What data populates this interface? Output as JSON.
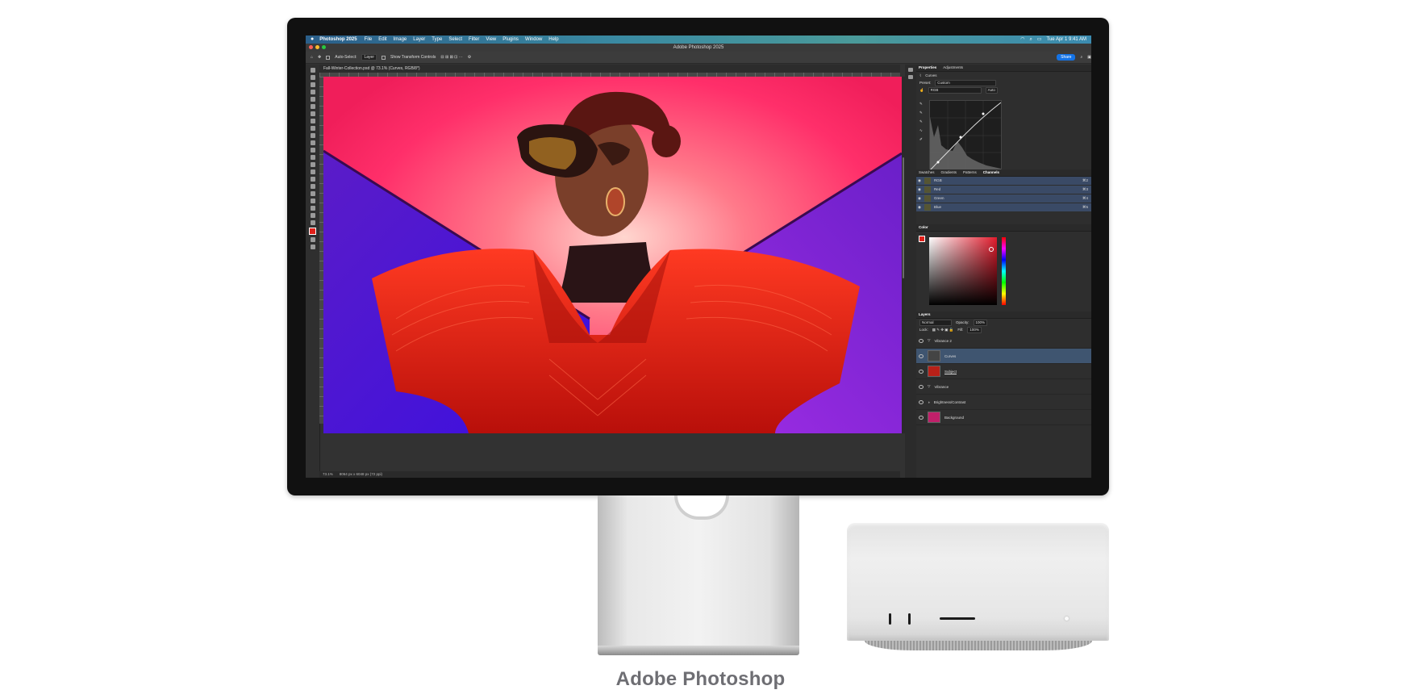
{
  "caption": "Adobe Photoshop",
  "menubar": {
    "app": "Photoshop 2025",
    "items": [
      "File",
      "Edit",
      "Image",
      "Layer",
      "Type",
      "Select",
      "Filter",
      "View",
      "Plugins",
      "Window",
      "Help"
    ],
    "datetime": "Tue Apr 1  9:41 AM"
  },
  "titlebar": {
    "title": "Adobe Photoshop 2025"
  },
  "options": {
    "auto_select": "Auto-Select:",
    "layer_value": "Layer",
    "transform": "Show Transform Controls",
    "share": "Share"
  },
  "document": {
    "tab": "Fall-Winter-Collection.psd @ 73.1% (Curves, RGB/8*)",
    "zoom": "73.1%",
    "size": "8064 px x 6048 px (72 ppi)"
  },
  "properties": {
    "tabs": [
      "Properties",
      "Adjustments"
    ],
    "section": "Curves",
    "preset_label": "Preset:",
    "preset_value": "Custom",
    "channel_value": "RGB",
    "auto": "Auto"
  },
  "channels_panel": {
    "tabs": [
      "Swatches",
      "Gradients",
      "Patterns",
      "Channels"
    ],
    "rows": [
      {
        "name": "RGB",
        "key": "⌘2"
      },
      {
        "name": "Red",
        "key": "⌘3"
      },
      {
        "name": "Green",
        "key": "⌘4"
      },
      {
        "name": "Blue",
        "key": "⌘5"
      }
    ]
  },
  "color_panel": {
    "title": "Color"
  },
  "layers_panel": {
    "title": "Layers",
    "blend": "Normal",
    "opacity_label": "Opacity:",
    "opacity": "100%",
    "lock_label": "Lock:",
    "fill_label": "Fill:",
    "fill": "100%",
    "layers": [
      {
        "name": "Vibrance 2"
      },
      {
        "name": "Curves"
      },
      {
        "name": "Subject"
      },
      {
        "name": "Vibrance"
      },
      {
        "name": "Brightness/Contrast"
      },
      {
        "name": "Background"
      }
    ]
  }
}
